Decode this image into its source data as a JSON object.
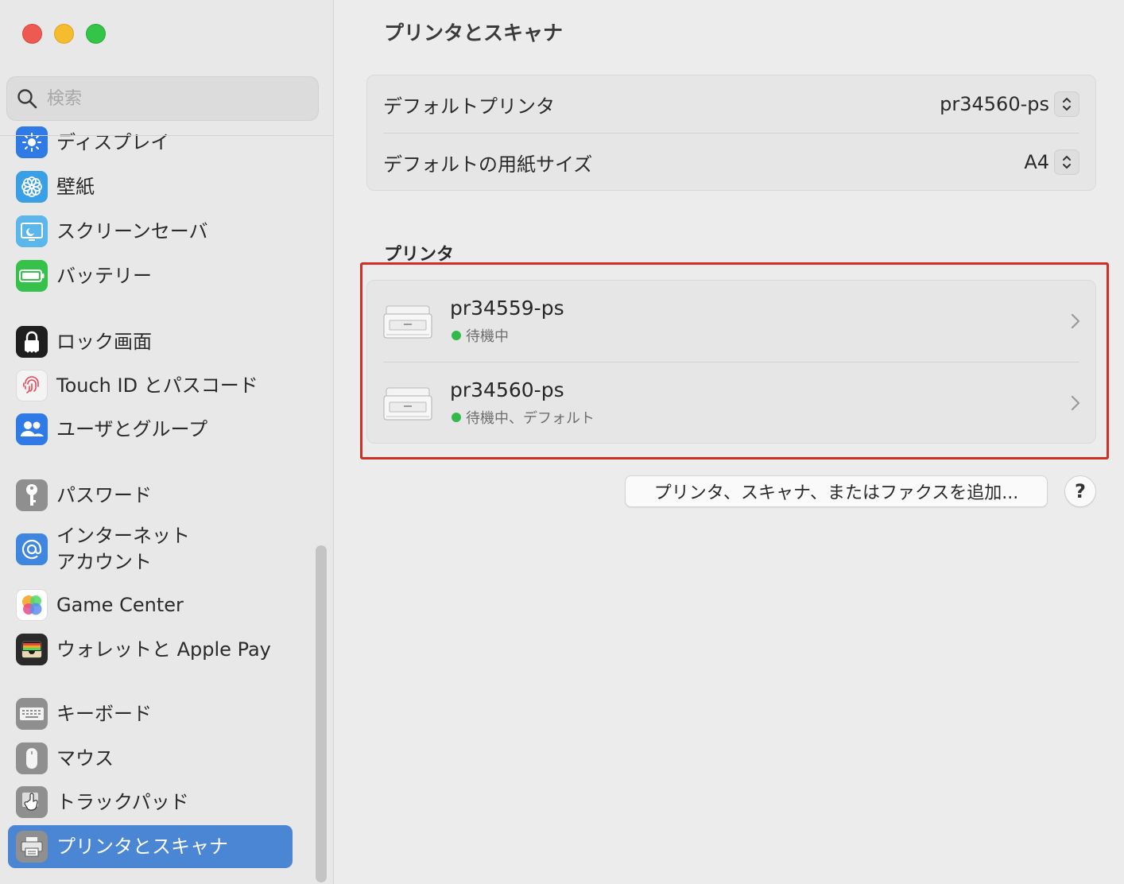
{
  "window": {
    "traffic_lights": [
      "close",
      "minimize",
      "zoom"
    ]
  },
  "sidebar": {
    "search": {
      "placeholder": "検索",
      "value": ""
    },
    "items": [
      {
        "label": "ディスプレイ",
        "icon": "sun-icon",
        "color": "#2f7ae5",
        "selected": false
      },
      {
        "label": "壁紙",
        "icon": "flower-icon",
        "color": "#3aa0e6",
        "selected": false
      },
      {
        "label": "スクリーンセーバ",
        "icon": "screensaver-icon",
        "color": "#5bb6ec",
        "selected": false
      },
      {
        "label": "バッテリー",
        "icon": "battery-icon",
        "color": "#36c24a",
        "selected": false
      },
      {
        "label": "ロック画面",
        "icon": "lock-icon",
        "color": "#1e1e1e",
        "selected": false
      },
      {
        "label": "Touch ID とパスコード",
        "icon": "fingerprint-icon",
        "color": "#f4f4f4",
        "selected": false
      },
      {
        "label": "ユーザとグループ",
        "icon": "users-icon",
        "color": "#2f7ae5",
        "selected": false
      },
      {
        "label": "パスワード",
        "icon": "key-icon",
        "color": "#8f8f8f",
        "selected": false
      },
      {
        "label": "インターネット\nアカウント",
        "label_line1": "インターネット",
        "label_line2": "アカウント",
        "icon": "at-icon",
        "color": "#3f86e0",
        "selected": false
      },
      {
        "label": "Game Center",
        "icon": "game-center-icon",
        "color": "#ffffff",
        "selected": false
      },
      {
        "label": "ウォレットと Apple Pay",
        "icon": "wallet-icon",
        "color": "#2a2a2a",
        "selected": false
      },
      {
        "label": "キーボード",
        "icon": "keyboard-icon",
        "color": "#8f8f8f",
        "selected": false
      },
      {
        "label": "マウス",
        "icon": "mouse-icon",
        "color": "#8f8f8f",
        "selected": false
      },
      {
        "label": "トラックパッド",
        "icon": "trackpad-icon",
        "color": "#8f8f8f",
        "selected": false
      },
      {
        "label": "プリンタとスキャナ",
        "icon": "printer-icon",
        "color": "#8f8f8f",
        "selected": true
      }
    ]
  },
  "main": {
    "title": "プリンタとスキャナ",
    "defaults": {
      "printer_label": "デフォルトプリンタ",
      "printer_value": "pr34560-ps",
      "paper_label": "デフォルトの用紙サイズ",
      "paper_value": "A4"
    },
    "printers_section_title": "プリンタ",
    "printers": [
      {
        "name": "pr34559-ps",
        "status": "待機中",
        "status_color": "#33b84a"
      },
      {
        "name": "pr34560-ps",
        "status": "待機中、デフォルト",
        "status_color": "#33b84a"
      }
    ],
    "add_button_label": "プリンタ、スキャナ、またはファクスを追加...",
    "help_button_label": "?",
    "highlight_color": "#d12f24"
  }
}
